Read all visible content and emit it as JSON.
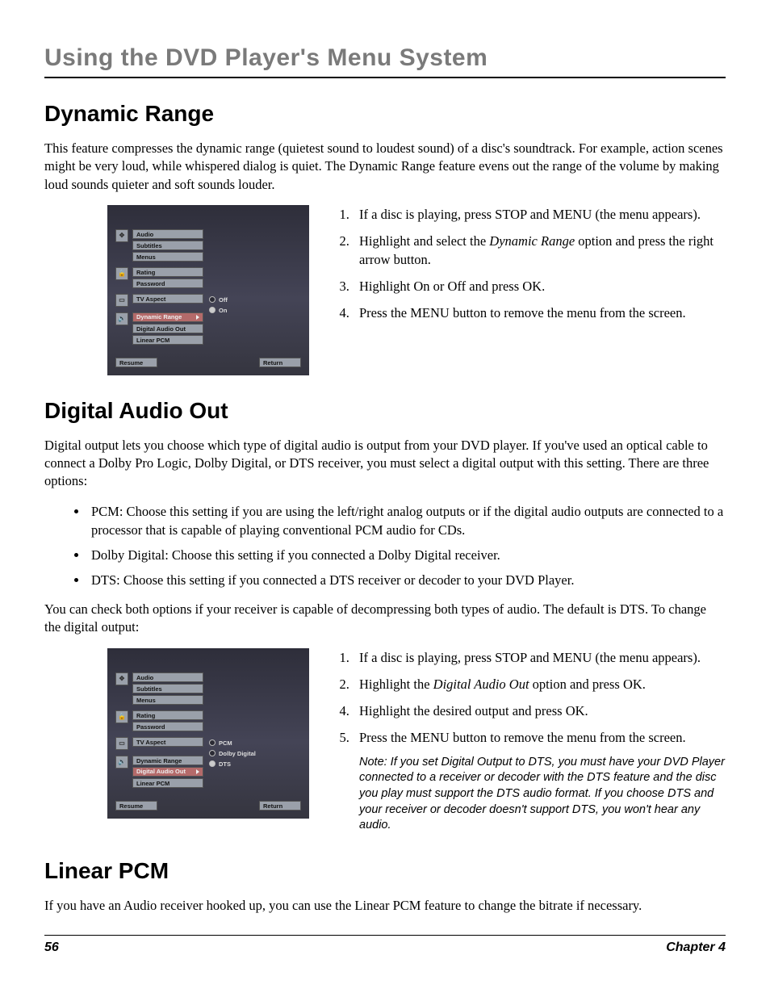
{
  "running_head": "Using the DVD Player's Menu System",
  "footer": {
    "page": "56",
    "chapter": "Chapter 4"
  },
  "section1": {
    "title": "Dynamic Range",
    "intro": "This feature compresses the dynamic range (quietest sound to loudest sound) of a disc's soundtrack. For example, action scenes might be very loud, while whispered dialog is quiet. The Dynamic Range feature evens out the range of the volume by making loud sounds quieter and soft sounds louder.",
    "steps": {
      "s1": "If a disc is playing, press STOP and MENU (the menu appears).",
      "s2a": "Highlight and select the ",
      "s2_em": "Dynamic Range",
      "s2b": " option and press the right arrow button.",
      "s3": "Highlight On or Off and press OK.",
      "s4": "Press the MENU button to remove the menu from the screen."
    },
    "figure": {
      "group1": [
        "Audio",
        "Subtitles",
        "Menus"
      ],
      "group2": [
        "Rating",
        "Password"
      ],
      "group3": [
        "TV Aspect"
      ],
      "group4": [
        "Dynamic Range",
        "Digital Audio Out",
        "Linear PCM"
      ],
      "highlight": "Dynamic Range",
      "submenu": [
        "Off",
        "On"
      ],
      "selected_index": 1,
      "resume": "Resume",
      "return": "Return"
    }
  },
  "section2": {
    "title": "Digital Audio Out",
    "intro": "Digital output lets you choose which type of digital audio is output from your DVD player. If you've used an optical cable to connect a Dolby Pro Logic, Dolby Digital, or DTS receiver, you must select a digital output with this setting. There are three options:",
    "bullets": {
      "b1": "PCM: Choose this setting if you are using the left/right analog outputs or if the digital audio outputs are connected to a processor that is capable of playing conventional PCM audio for CDs.",
      "b2": "Dolby Digital: Choose this setting if you connected a Dolby Digital receiver.",
      "b3": "DTS:  Choose this setting if you connected a DTS receiver or decoder to your DVD Player."
    },
    "after_bullets": "You can check both options if your receiver is capable of decompressing both types of audio. The default is DTS. To change the digital output:",
    "steps": {
      "s1": "If a disc is playing, press STOP and MENU (the menu appears).",
      "s2a": "Highlight the ",
      "s2_em": "Digital Audio Out",
      "s2b": " option and press OK.",
      "s4": "Highlight the desired output and press OK.",
      "s5": "Press the MENU button to remove the menu from the screen."
    },
    "note": "Note: If you set Digital Output to DTS, you must have your DVD Player connected to a receiver or decoder with the DTS feature and the disc you play must support the DTS audio format. If you choose DTS and your receiver or decoder doesn't support DTS, you won't hear any audio.",
    "figure": {
      "group1": [
        "Audio",
        "Subtitles",
        "Menus"
      ],
      "group2": [
        "Rating",
        "Password"
      ],
      "group3": [
        "TV Aspect"
      ],
      "group4": [
        "Dynamic Range",
        "Digital Audio Out",
        "Linear PCM"
      ],
      "highlight": "Digital Audio Out",
      "submenu": [
        "PCM",
        "Dolby Digital",
        "DTS"
      ],
      "selected_index": 2,
      "resume": "Resume",
      "return": "Return"
    }
  },
  "section3": {
    "title": "Linear PCM",
    "intro": "If you have an Audio receiver hooked up, you can use the Linear PCM feature to change the bitrate if necessary."
  }
}
